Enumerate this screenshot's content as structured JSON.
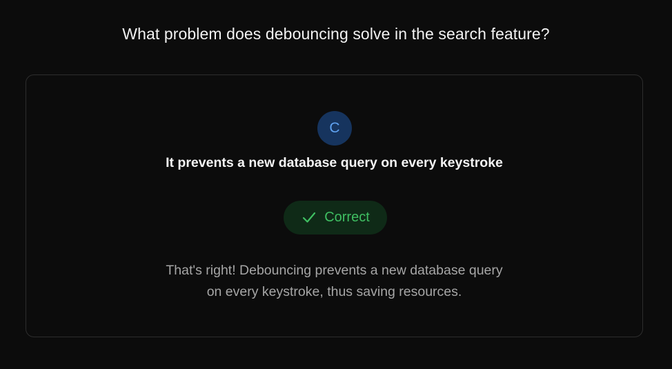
{
  "question": {
    "text": "What problem does debouncing solve in the search feature?"
  },
  "answer_card": {
    "letter": "C",
    "answer_text": "It prevents a new database query on every keystroke",
    "result": {
      "label": "Correct",
      "icon": "checkmark-icon",
      "color": "#3fbf62",
      "background": "#0f2a17"
    },
    "feedback_lines": [
      "That's right! Debouncing prevents a new database query",
      "on every keystroke, thus saving resources."
    ]
  },
  "colors": {
    "page_background": "#0c0c0c",
    "badge_background": "#16345e",
    "badge_text": "#5fa2f0",
    "card_border": "#2e2e2e"
  }
}
